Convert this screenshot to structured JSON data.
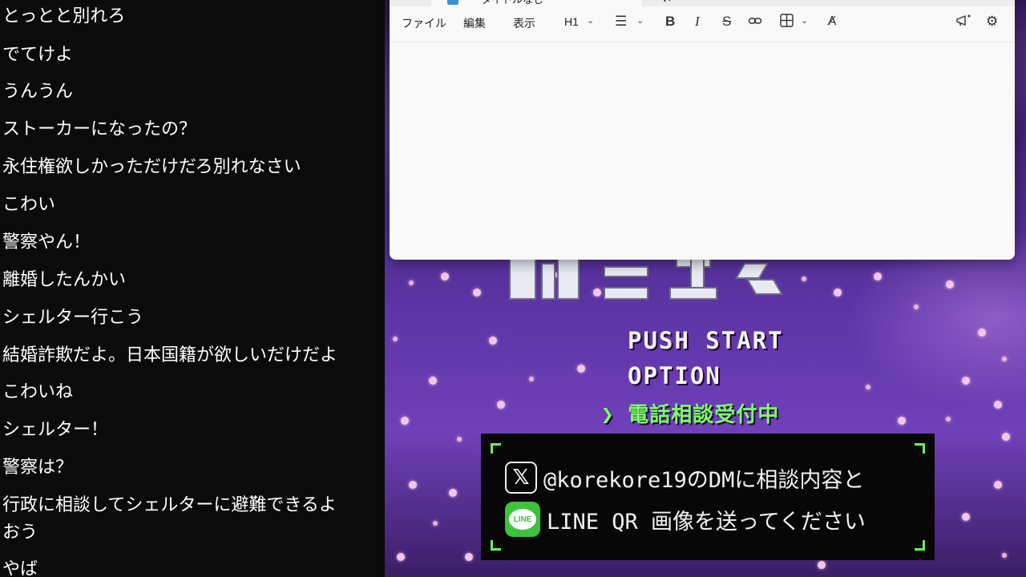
{
  "chat": {
    "messages": [
      "とっとと別れろ",
      "でてけよ",
      "うんうん",
      "ストーカーになったの？",
      "永住権欲しかっただけだろ別れなさい",
      "こわい",
      "警察やん！",
      "離婚したんかい",
      "シェルター行こう",
      "結婚詐欺だよ。日本国籍が欲しいだけだよ",
      "こわいね",
      "シェルター！",
      "警察は？",
      "行政に相談してシェルターに避難できるよ",
      "おう",
      "やば"
    ]
  },
  "notepad": {
    "tab_title": "タイトルなし",
    "tab_close": "×",
    "new_tab": "+",
    "menu": {
      "file": "ファイル",
      "edit": "編集",
      "view": "表示"
    },
    "heading_button": "H1",
    "bold": "B",
    "italic": "I",
    "strike": "S"
  },
  "game": {
    "push_start": "PUSH START",
    "option": "OPTION",
    "phone_consult": "❯ 電話相談受付中",
    "info_line1": "@korekore19のDMに相談内容と",
    "info_line2": "LINE QR 画像を送ってください",
    "x_icon_glyph": "𝕏",
    "line_icon_label": "LINE",
    "accent_green": "#6ef05a"
  }
}
